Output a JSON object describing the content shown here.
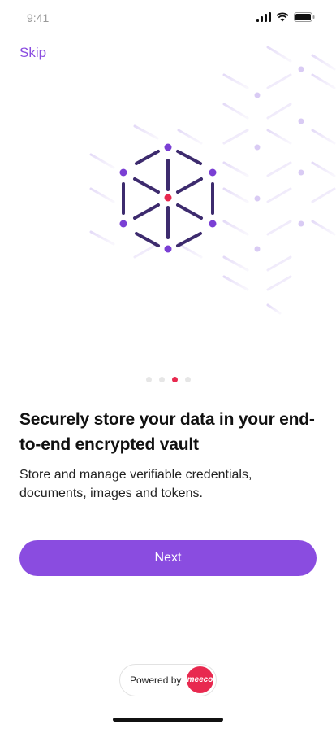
{
  "status_bar": {
    "time": "9:41",
    "icons": [
      "signal-icon",
      "wifi-icon",
      "battery-icon"
    ]
  },
  "nav": {
    "skip_label": "Skip"
  },
  "pagination": {
    "total": 4,
    "active_index": 2
  },
  "content": {
    "title": "Securely store your data in your end-to-end encrypted vault",
    "subtitle": "Store and manage verifiable credentials, documents, images and tokens."
  },
  "actions": {
    "next_label": "Next"
  },
  "footer": {
    "powered_by_label": "Powered by",
    "brand": "meeco"
  },
  "colors": {
    "accent": "#8a4ce0",
    "brand_red": "#e8294f",
    "hexagon": "#3d2b6e"
  }
}
